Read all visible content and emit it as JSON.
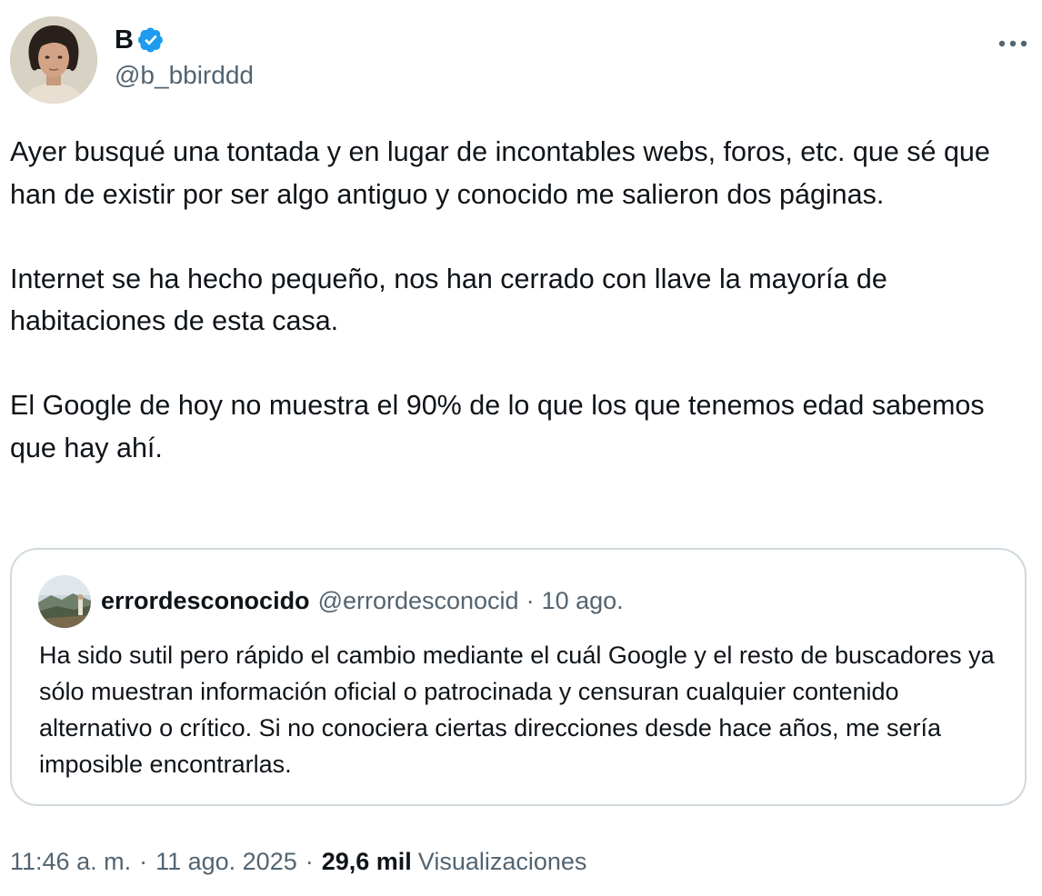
{
  "author": {
    "name": "B",
    "handle": "@b_bbirddd",
    "verified": true
  },
  "tweet": {
    "paragraphs": [
      "Ayer busqué una tontada y en lugar de incontables webs, foros, etc. que sé que han de existir por ser algo antiguo y conocido me salieron dos páginas.",
      "Internet se ha hecho pequeño, nos han cerrado con llave la mayoría de habitaciones de esta casa.",
      "El Google de hoy no muestra el 90% de lo que los que tenemos edad sabemos que hay ahí."
    ]
  },
  "quoted_tweet": {
    "name": "errordesconocido",
    "handle": "@errordesconocid",
    "separator": "·",
    "date": "10 ago.",
    "text": "Ha sido sutil pero rápido el cambio mediante el cuál Google y el resto de buscadores ya sólo muestran información oficial o patrocinada y censuran cualquier contenido alternativo o crítico. Si no conociera ciertas direcciones desde hace años, me sería imposible encontrarlas."
  },
  "meta": {
    "time": "11:46 a. m.",
    "separator": "·",
    "date": "11 ago. 2025",
    "views_count": "29,6 mil",
    "views_label": "Visualizaciones"
  },
  "colors": {
    "text_primary": "#0f1419",
    "text_secondary": "#536471",
    "verified_blue": "#1d9bf0",
    "border": "#cfd9de"
  },
  "icons": {
    "verified": "verified-badge-icon",
    "more": "more-horizontal-icon"
  }
}
